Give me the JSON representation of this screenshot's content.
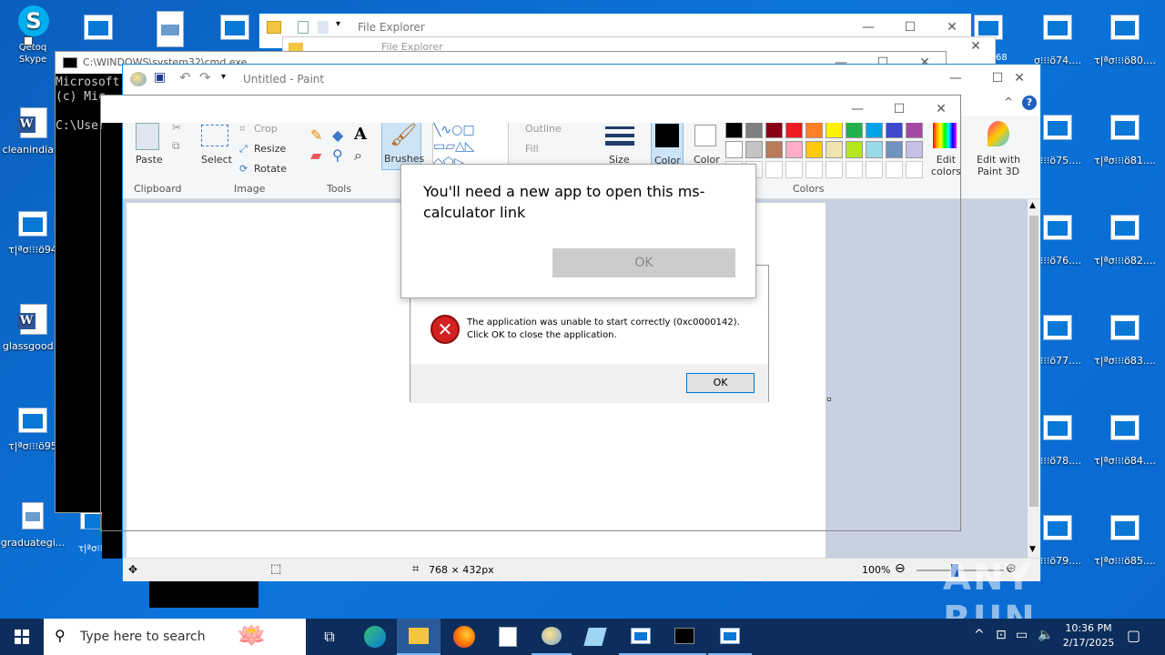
{
  "desktop": {
    "left_icons": [
      {
        "id": "skype",
        "label": "Qetoq\nSkype"
      },
      {
        "id": "cleanindia",
        "label": "cleanindia..."
      },
      {
        "id": "t94",
        "label": "τ|ªσ⁝⁝⁝ö94"
      },
      {
        "id": "glassgood",
        "label": "glassgood..."
      },
      {
        "id": "t95",
        "label": "τ|ªσ⁝⁝⁝ö95"
      },
      {
        "id": "graduategi",
        "label": "graduategi..."
      }
    ],
    "right_icons": [
      {
        "label": "σ⁝⁝⁝ö74...."
      },
      {
        "label": "τ|ªσ⁝⁝⁝ö80...."
      },
      {
        "label": "σ⁝⁝⁝ö75...."
      },
      {
        "label": "τ|ªσ⁝⁝⁝ö81...."
      },
      {
        "label": "σ⁝⁝⁝ö76...."
      },
      {
        "label": "τ|ªσ⁝⁝⁝ö82...."
      },
      {
        "label": "σ⁝⁝⁝ö77...."
      },
      {
        "label": "τ|ªσ⁝⁝⁝ö83...."
      },
      {
        "label": "σ⁝⁝⁝ö78...."
      },
      {
        "label": "τ|ªσ⁝⁝⁝ö84...."
      },
      {
        "label": "σ⁝⁝⁝ö79...."
      },
      {
        "label": "τ|ªσ⁝⁝⁝ö85...."
      }
    ],
    "small_labels": {
      "r68": "68",
      "bottom_left": "τ|ªσ⁝⁝⁝"
    }
  },
  "file_explorer": {
    "title": "File Explorer",
    "title2": "File Explorer"
  },
  "cmd": {
    "title": "C:\\WINDOWS\\system32\\cmd.exe",
    "line1": "Microsoft",
    "line2": "(c) Mic",
    "line3": "C:\\Users\\a"
  },
  "paint": {
    "title": "Untitled - Paint",
    "ribbon": {
      "paste": "Paste",
      "clipboard": "Clipboard",
      "crop": "Crop",
      "resize": "Resize",
      "rotate": "Rotate",
      "select": "Select",
      "image": "Image",
      "tools": "Tools",
      "brushes": "Brushes",
      "outline": "Outline",
      "fill": "Fill",
      "size": "Size",
      "color1": "Color\n1",
      "color2": "Color\n2",
      "colors": "Colors",
      "edit_colors": "Edit\ncolors",
      "paint3d": "Edit with\nPaint 3D"
    },
    "palette_row1": [
      "#000000",
      "#7f7f7f",
      "#880015",
      "#ed1c24",
      "#ff7f27",
      "#fff200",
      "#22b14c",
      "#00a2e8",
      "#3f48cc",
      "#a349a4"
    ],
    "palette_row2": [
      "#ffffff",
      "#c3c3c3",
      "#b97a57",
      "#ffaec9",
      "#ffc90e",
      "#efe4b0",
      "#b5e61d",
      "#99d9ea",
      "#7092be",
      "#c8bfe7"
    ],
    "status": {
      "dimensions": "768 × 432px",
      "zoom": "100%"
    }
  },
  "dialog_app": {
    "message": "You'll need a new app to open this ms-calculator link",
    "ok": "OK"
  },
  "dialog_error": {
    "message": "The application was unable to start correctly (0xc0000142). Click OK to close the application.",
    "ok": "OK"
  },
  "taskbar": {
    "search_placeholder": "Type here to search",
    "time": "10:36 PM",
    "date": "2/17/2025"
  },
  "watermark": "ANY RUN"
}
